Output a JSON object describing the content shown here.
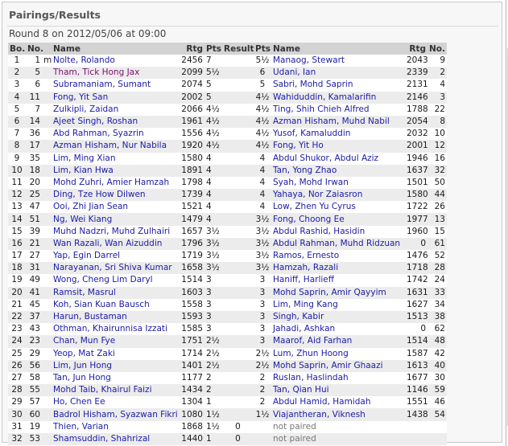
{
  "title": "Pairings/Results",
  "subtitle": "Round 8 on 2012/05/06 at 09:00",
  "headers": [
    "Bo.",
    "No.",
    "Name",
    "Rtg",
    "Pts.",
    "Result",
    "Pts.",
    "Name",
    "Rtg",
    "No."
  ],
  "rows": [
    {
      "bo": "1",
      "no": "1",
      "m": "m",
      "name": "Nolte, Rolando",
      "rtg": "2456",
      "pts": "7",
      "res": "",
      "pts2": "5½",
      "name2": "Manaog, Stewart",
      "rtg2": "2043",
      "no2": "9"
    },
    {
      "bo": "2",
      "no": "5",
      "m": "",
      "name": "Tham, Tick Hong Jax",
      "rtg": "2099",
      "pts": "5½",
      "res": "",
      "pts2": "6",
      "name2": "Udani, Ian",
      "rtg2": "2339",
      "no2": "2"
    },
    {
      "bo": "3",
      "no": "6",
      "m": "",
      "name": "Subramaniam, Sumant",
      "rtg": "2074",
      "pts": "5",
      "res": "",
      "pts2": "5",
      "name2": "Sabri, Mohd Saprin",
      "rtg2": "2131",
      "no2": "4"
    },
    {
      "bo": "4",
      "no": "11",
      "m": "",
      "name": "Fong, Yit San",
      "rtg": "2002",
      "pts": "5",
      "res": "",
      "pts2": "4½",
      "name2": "Wahiduddin, Kamalarifin",
      "rtg2": "2146",
      "no2": "3"
    },
    {
      "bo": "5",
      "no": "7",
      "m": "",
      "name": "Zulkipli, Zaidan",
      "rtg": "2066",
      "pts": "4½",
      "res": "",
      "pts2": "4½",
      "name2": "Ting, Shih Chieh Alfred",
      "rtg2": "1788",
      "no2": "22"
    },
    {
      "bo": "6",
      "no": "14",
      "m": "",
      "name": "Ajeet Singh, Roshan",
      "rtg": "1961",
      "pts": "4½",
      "res": "",
      "pts2": "4½",
      "name2": "Azman Hisham, Muhd Nabil",
      "rtg2": "2054",
      "no2": "8"
    },
    {
      "bo": "7",
      "no": "36",
      "m": "",
      "name": "Abd Rahman, Syazrin",
      "rtg": "1556",
      "pts": "4½",
      "res": "",
      "pts2": "4½",
      "name2": "Yusof, Kamaluddin",
      "rtg2": "2032",
      "no2": "10"
    },
    {
      "bo": "8",
      "no": "17",
      "m": "",
      "name": "Azman Hisham, Nur Nabila",
      "rtg": "1920",
      "pts": "4½",
      "res": "",
      "pts2": "4½",
      "name2": "Fong, Yit Ho",
      "rtg2": "2001",
      "no2": "12"
    },
    {
      "bo": "9",
      "no": "35",
      "m": "",
      "name": "Lim, Ming Xian",
      "rtg": "1580",
      "pts": "4",
      "res": "",
      "pts2": "4",
      "name2": "Abdul Shukor, Abdul Aziz",
      "rtg2": "1946",
      "no2": "16"
    },
    {
      "bo": "10",
      "no": "18",
      "m": "",
      "name": "Lim, Kian Hwa",
      "rtg": "1891",
      "pts": "4",
      "res": "",
      "pts2": "4",
      "name2": "Tan, Yong Zhao",
      "rtg2": "1637",
      "no2": "32"
    },
    {
      "bo": "11",
      "no": "20",
      "m": "",
      "name": "Mohd Zuhri, Amier Hamzah",
      "rtg": "1798",
      "pts": "4",
      "res": "",
      "pts2": "4",
      "name2": "Syah, Mohd Irwan",
      "rtg2": "1501",
      "no2": "50"
    },
    {
      "bo": "12",
      "no": "25",
      "m": "",
      "name": "Ding, Tze How Dilwen",
      "rtg": "1739",
      "pts": "4",
      "res": "",
      "pts2": "4",
      "name2": "Yahaya, Nor Zaiasron",
      "rtg2": "1580",
      "no2": "44"
    },
    {
      "bo": "13",
      "no": "47",
      "m": "",
      "name": "Ooi, Zhi Jian Sean",
      "rtg": "1521",
      "pts": "4",
      "res": "",
      "pts2": "4",
      "name2": "Low, Zhen Yu Cyrus",
      "rtg2": "1722",
      "no2": "26"
    },
    {
      "bo": "14",
      "no": "51",
      "m": "",
      "name": "Ng, Wei Kiang",
      "rtg": "1479",
      "pts": "4",
      "res": "",
      "pts2": "3½",
      "name2": "Fong, Choong Ee",
      "rtg2": "1977",
      "no2": "13"
    },
    {
      "bo": "15",
      "no": "39",
      "m": "",
      "name": "Muhd Nadzri, Muhd Zulhairi",
      "rtg": "1657",
      "pts": "3½",
      "res": "",
      "pts2": "3½",
      "name2": "Abdul Rashid, Hasidin",
      "rtg2": "1960",
      "no2": "15"
    },
    {
      "bo": "16",
      "no": "21",
      "m": "",
      "name": "Wan Razali, Wan Aizuddin",
      "rtg": "1796",
      "pts": "3½",
      "res": "",
      "pts2": "3½",
      "name2": "Abdul Rahman, Muhd Ridzuan",
      "rtg2": "0",
      "no2": "61"
    },
    {
      "bo": "17",
      "no": "27",
      "m": "",
      "name": "Yap, Egin Darrel",
      "rtg": "1719",
      "pts": "3½",
      "res": "",
      "pts2": "3½",
      "name2": "Ramos, Ernesto",
      "rtg2": "1476",
      "no2": "52"
    },
    {
      "bo": "18",
      "no": "31",
      "m": "",
      "name": "Narayanan, Sri Shiva Kumar",
      "rtg": "1658",
      "pts": "3½",
      "res": "",
      "pts2": "3½",
      "name2": "Hamzah, Razali",
      "rtg2": "1718",
      "no2": "28"
    },
    {
      "bo": "19",
      "no": "49",
      "m": "",
      "name": "Wong, Cheng Lim Daryl",
      "rtg": "1514",
      "pts": "3",
      "res": "",
      "pts2": "3",
      "name2": "Haniff, Harlieff",
      "rtg2": "1742",
      "no2": "24"
    },
    {
      "bo": "20",
      "no": "41",
      "m": "",
      "name": "Ramsit, Masrul",
      "rtg": "1603",
      "pts": "3",
      "res": "",
      "pts2": "3",
      "name2": "Mohd Saprin, Amir Qayyim",
      "rtg2": "1631",
      "no2": "33"
    },
    {
      "bo": "21",
      "no": "45",
      "m": "",
      "name": "Koh, Sian Kuan Bausch",
      "rtg": "1558",
      "pts": "3",
      "res": "",
      "pts2": "3",
      "name2": "Lim, Ming Kang",
      "rtg2": "1627",
      "no2": "34"
    },
    {
      "bo": "22",
      "no": "37",
      "m": "",
      "name": "Harun, Bustaman",
      "rtg": "1593",
      "pts": "3",
      "res": "",
      "pts2": "3",
      "name2": "Singh, Kabir",
      "rtg2": "1513",
      "no2": "38"
    },
    {
      "bo": "23",
      "no": "43",
      "m": "",
      "name": "Othman, Khairunnisa Izzati",
      "rtg": "1585",
      "pts": "3",
      "res": "",
      "pts2": "3",
      "name2": "Jahadi, Ashkan",
      "rtg2": "0",
      "no2": "62"
    },
    {
      "bo": "24",
      "no": "23",
      "m": "",
      "name": "Chan, Mun Fye",
      "rtg": "1751",
      "pts": "2½",
      "res": "",
      "pts2": "3",
      "name2": "Maarof, Aid Farhan",
      "rtg2": "1514",
      "no2": "48"
    },
    {
      "bo": "25",
      "no": "29",
      "m": "",
      "name": "Yeop, Mat Zaki",
      "rtg": "1714",
      "pts": "2½",
      "res": "",
      "pts2": "2½",
      "name2": "Lum, Zhun Hoong",
      "rtg2": "1587",
      "no2": "42"
    },
    {
      "bo": "26",
      "no": "56",
      "m": "",
      "name": "Lim, Jun Hong",
      "rtg": "1401",
      "pts": "2½",
      "res": "",
      "pts2": "2½",
      "name2": "Mohd Saprin, Amir Ghaazi",
      "rtg2": "1613",
      "no2": "40"
    },
    {
      "bo": "27",
      "no": "58",
      "m": "",
      "name": "Tan, Jun Hong",
      "rtg": "1177",
      "pts": "2",
      "res": "",
      "pts2": "2",
      "name2": "Ruslan, Haslindah",
      "rtg2": "1677",
      "no2": "30"
    },
    {
      "bo": "28",
      "no": "55",
      "m": "",
      "name": "Mohd Taib, Khairul Faizi",
      "rtg": "1434",
      "pts": "2",
      "res": "",
      "pts2": "2",
      "name2": "Tan, Qian Hui",
      "rtg2": "1146",
      "no2": "59"
    },
    {
      "bo": "29",
      "no": "57",
      "m": "",
      "name": "Ho, Chen Ee",
      "rtg": "1304",
      "pts": "1",
      "res": "",
      "pts2": "2",
      "name2": "Abdul Hamid, Hamidah",
      "rtg2": "1551",
      "no2": "46"
    },
    {
      "bo": "30",
      "no": "60",
      "m": "",
      "name": "Badrol Hisham, Syazwan Fikri",
      "rtg": "1080",
      "pts": "1½",
      "res": "",
      "pts2": "1½",
      "name2": "Viajantheran, Viknesh",
      "rtg2": "1438",
      "no2": "54"
    },
    {
      "bo": "31",
      "no": "19",
      "m": "",
      "name": "Thien, Varian",
      "rtg": "1868",
      "pts": "1½",
      "res": "0",
      "pts2": "",
      "name2": "not paired",
      "rtg2": "",
      "no2": ""
    },
    {
      "bo": "32",
      "no": "53",
      "m": "",
      "name": "Shamsuddin, Shahrizal",
      "rtg": "1440",
      "pts": "1",
      "res": "0",
      "pts2": "",
      "name2": "not paired",
      "rtg2": "",
      "no2": ""
    }
  ]
}
